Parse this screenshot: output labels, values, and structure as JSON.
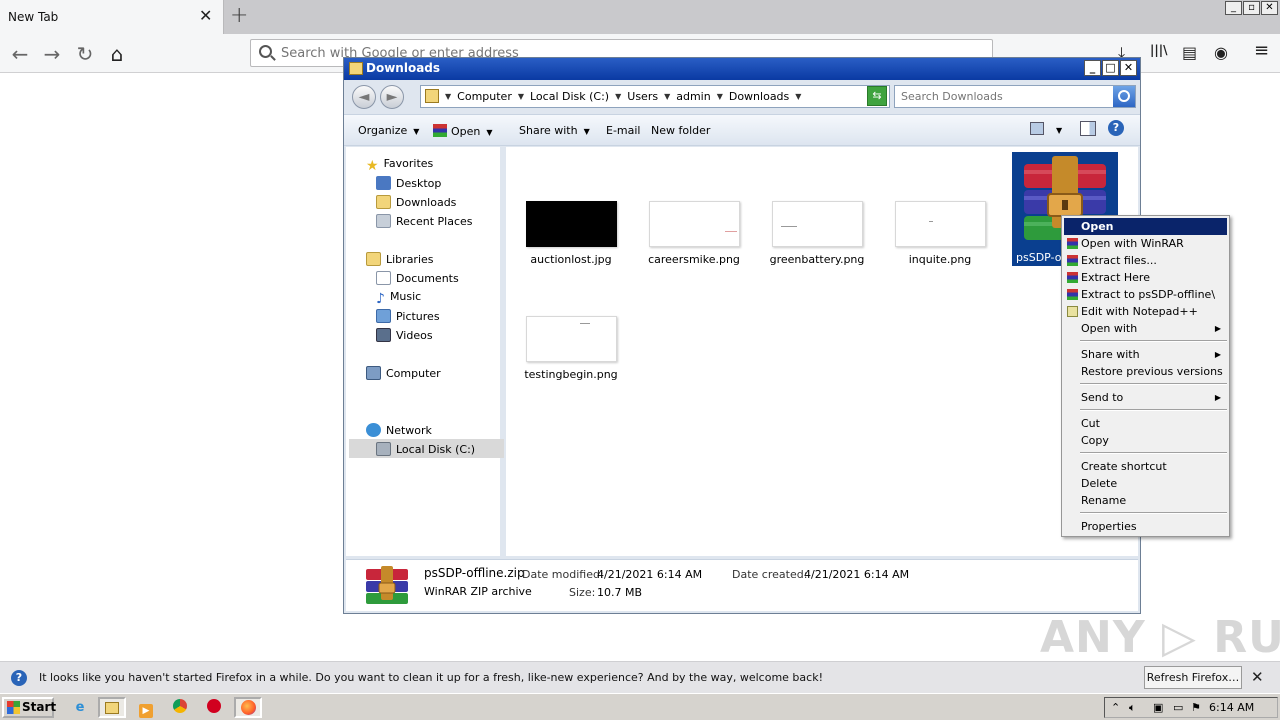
{
  "browser": {
    "tab_title": "New Tab",
    "tab_close": "✕",
    "new_tab": "+",
    "url_placeholder": "Search with Google or enter address",
    "window_buttons": [
      "_",
      "▫",
      "✕"
    ],
    "nav_back": "←",
    "nav_forward": "→",
    "nav_reload": "↻",
    "nav_home": "⌂",
    "tool_downloads": "⤓",
    "tool_library": "|||\\",
    "tool_sidebar": "▤",
    "tool_account": "◉",
    "tool_menu": "≡"
  },
  "explorer": {
    "title": "Downloads",
    "window_buttons": [
      "_",
      "□",
      "✕"
    ],
    "nav_back": "◄",
    "nav_forward": "►",
    "breadcrumbs": [
      "Computer",
      "Local Disk (C:)",
      "Users",
      "admin",
      "Downloads"
    ],
    "search_placeholder": "Search Downloads",
    "toolbar": {
      "organize": "Organize",
      "open": "Open",
      "share_with": "Share with",
      "email": "E-mail",
      "new_folder": "New folder"
    },
    "nav_pane": {
      "favorites": "Favorites",
      "desktop": "Desktop",
      "downloads": "Downloads",
      "recent_places": "Recent Places",
      "libraries": "Libraries",
      "documents": "Documents",
      "music": "Music",
      "pictures": "Pictures",
      "videos": "Videos",
      "computer": "Computer",
      "local_disk": "Local Disk (C:)",
      "network": "Network"
    },
    "files": [
      {
        "name": "auctionlost.jpg"
      },
      {
        "name": "careersmike.png"
      },
      {
        "name": "greenbattery.png"
      },
      {
        "name": "inquite.png"
      },
      {
        "name": "testingbegin.png"
      }
    ],
    "selected_file": "psSDP-offline.zip",
    "details": {
      "name": "psSDP-offline.zip",
      "type": "WinRAR ZIP archive",
      "modified_label": "Date modified:",
      "modified_value": "4/21/2021 6:14 AM",
      "created_label": "Date created:",
      "created_value": "4/21/2021 6:14 AM",
      "size_label": "Size:",
      "size_value": "10.7 MB"
    }
  },
  "context_menu": {
    "items": [
      {
        "label": "Open"
      },
      {
        "label": "Open with WinRAR"
      },
      {
        "label": "Extract files..."
      },
      {
        "label": "Extract Here"
      },
      {
        "label": "Extract to psSDP-offline\\"
      },
      {
        "label": "Edit with Notepad++"
      },
      {
        "label": "Open with"
      },
      {
        "label": "Share with"
      },
      {
        "label": "Restore previous versions"
      },
      {
        "label": "Send to"
      },
      {
        "label": "Cut"
      },
      {
        "label": "Copy"
      },
      {
        "label": "Create shortcut"
      },
      {
        "label": "Delete"
      },
      {
        "label": "Rename"
      },
      {
        "label": "Properties"
      }
    ]
  },
  "notification": {
    "text": "It looks like you haven't started Firefox in a while. Do you want to clean it up for a fresh, like-new experience? And by the way, welcome back!",
    "button": "Refresh Firefox…",
    "close": "✕"
  },
  "taskbar": {
    "start": "Start",
    "clock": "6:14 AM"
  },
  "watermark": "ANY RUN"
}
